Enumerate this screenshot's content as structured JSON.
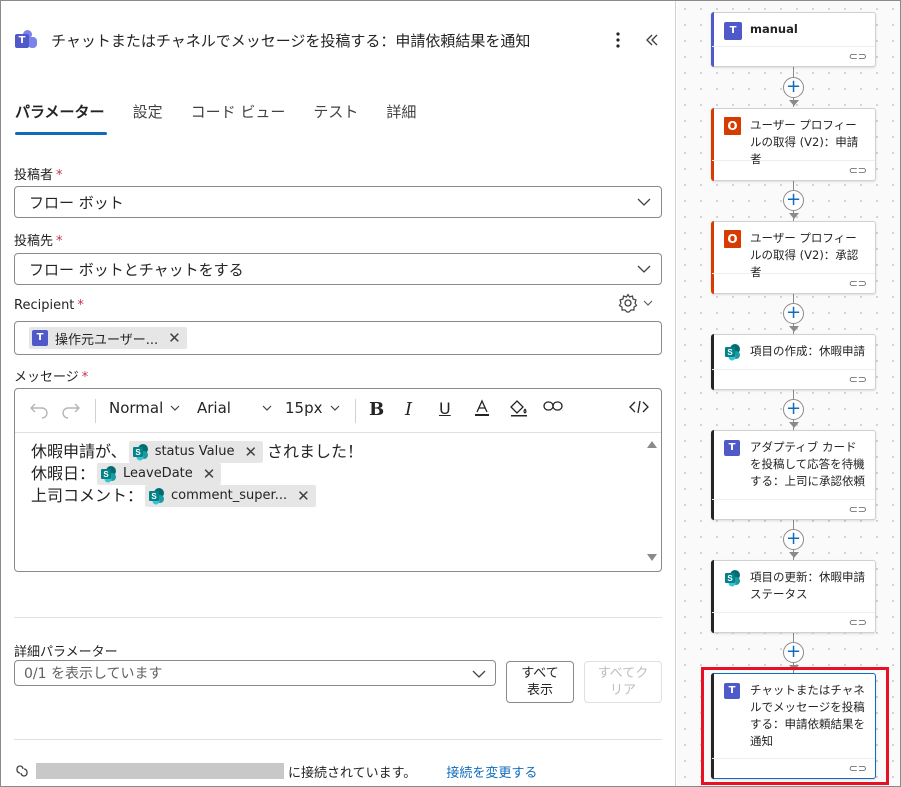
{
  "header": {
    "title": "チャットまたはチャネルでメッセージを投稿する：申請依頼結果を通知",
    "more_icon": "more-vertical-icon",
    "collapse_icon": "collapse-left-icon"
  },
  "tabs": [
    {
      "label": "パラメーター",
      "active": true
    },
    {
      "label": "設定",
      "active": false
    },
    {
      "label": "コード ビュー",
      "active": false
    },
    {
      "label": "テスト",
      "active": false
    },
    {
      "label": "詳細",
      "active": false
    }
  ],
  "fields": {
    "poster": {
      "label": "投稿者",
      "required": "*",
      "value": "フロー ボット"
    },
    "post_in": {
      "label": "投稿先",
      "required": "*",
      "value": "フロー ボットとチャットをする"
    },
    "recipient": {
      "label": "Recipient",
      "required": "*",
      "token": "操作元ユーザー..."
    },
    "message": {
      "label": "メッセージ",
      "required": "*"
    }
  },
  "editor": {
    "toolbar": {
      "font_style": "Normal",
      "font_family": "Arial",
      "font_size": "15px"
    },
    "lines": [
      {
        "before": "休暇申請が、",
        "token": "status Value",
        "after": "されました！"
      },
      {
        "before": "休暇日：",
        "token": "LeaveDate",
        "after": ""
      },
      {
        "before": "上司コメント：",
        "token": "comment_super...",
        "after": ""
      }
    ]
  },
  "advanced": {
    "label": "詳細パラメーター",
    "select_value": "0/1 を表示しています",
    "show_all": "すべて表示",
    "clear_all": "すべてクリア"
  },
  "connection": {
    "status_text": "に接続されています。",
    "change_link": "接続を変更する"
  },
  "flow": {
    "cards": [
      {
        "title": "manual",
        "icon": "teams-icon",
        "accent": "#5059c9"
      },
      {
        "title": "ユーザー プロフィールの取得 (V2)：申請者",
        "icon": "office365-icon",
        "accent": "#d83b01"
      },
      {
        "title": "ユーザー プロフィールの取得 (V2)：承認者",
        "icon": "office365-icon",
        "accent": "#d83b01"
      },
      {
        "title": "項目の作成：休暇申請",
        "icon": "sharepoint-icon",
        "accent": "#242424"
      },
      {
        "title": "アダプティブ カードを投稿して応答を待機する：上司に承認依頼",
        "icon": "teams-icon",
        "accent": "#242424"
      },
      {
        "title": "項目の更新：休暇申請ステータス",
        "icon": "sharepoint-icon",
        "accent": "#242424"
      },
      {
        "title": "チャットまたはチャネルでメッセージを投稿する：申請依頼結果を通知",
        "icon": "teams-icon",
        "accent": "#242424",
        "selected": true
      }
    ]
  },
  "colors": {
    "accent": "#0f6cbd",
    "highlight": "#e81123",
    "teams": "#5059c9",
    "office": "#d83b01",
    "sharepoint": "#038387"
  }
}
